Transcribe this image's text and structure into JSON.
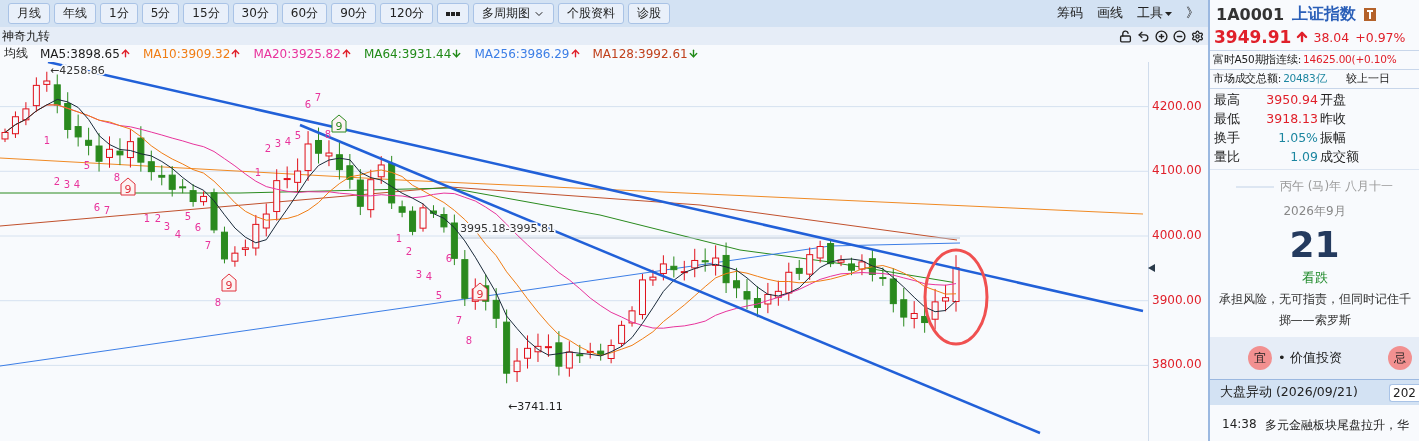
{
  "toolbar": {
    "periods": [
      {
        "kind": "text",
        "label": "月线"
      },
      {
        "kind": "text",
        "label": "年线"
      },
      {
        "kind": "text",
        "label": "1分"
      },
      {
        "kind": "text",
        "label": "5分"
      },
      {
        "kind": "text",
        "label": "15分"
      },
      {
        "kind": "text",
        "label": "30分"
      },
      {
        "kind": "text",
        "label": "60分"
      },
      {
        "kind": "text",
        "label": "90分"
      },
      {
        "kind": "text",
        "label": "120分"
      },
      {
        "kind": "more"
      },
      {
        "kind": "dropdown",
        "label": "多周期图"
      },
      {
        "kind": "text",
        "label": "个股资料"
      },
      {
        "kind": "text",
        "label": "诊股"
      }
    ],
    "links": [
      {
        "kind": "text",
        "label": "筹码"
      },
      {
        "kind": "text",
        "label": "画线"
      },
      {
        "kind": "dropdown",
        "label": "工具"
      },
      {
        "kind": "text",
        "label": "》"
      }
    ]
  },
  "indicator_bar": {
    "title": "神奇九转"
  },
  "legend": {
    "label": "均线",
    "items": [
      {
        "text": "MA5:3898.65",
        "color": "#1a1a1a",
        "rising": true
      },
      {
        "text": "MA10:3909.32",
        "color": "#f07d14",
        "rising": true
      },
      {
        "text": "MA20:3925.82",
        "color": "#e8339c",
        "rising": true
      },
      {
        "text": "MA64:3931.44",
        "color": "#218a18",
        "rising": false
      },
      {
        "text": "MA256:3986.29",
        "color": "#3c7ee6",
        "rising": true
      },
      {
        "text": "MA128:3992.61",
        "color": "#c0401c",
        "rising": false
      }
    ]
  },
  "chart": {
    "price_axis": [
      "4200.00",
      "4100.00",
      "4000.00",
      "3900.00",
      "3800.00"
    ],
    "annotations": [
      {
        "kind": "high",
        "text": "←4258.86"
      },
      {
        "kind": "range",
        "text": "3995.18-3995.81"
      },
      {
        "kind": "low",
        "text": "←3741.11"
      }
    ],
    "td_marks": [
      {
        "kind": "number",
        "text": "1"
      },
      {
        "kind": "number",
        "text": "2"
      },
      {
        "kind": "number",
        "text": "3"
      },
      {
        "kind": "number",
        "text": "4"
      },
      {
        "kind": "number",
        "text": "5"
      },
      {
        "kind": "number",
        "text": "6"
      },
      {
        "kind": "number",
        "text": "7"
      },
      {
        "kind": "number",
        "text": "8"
      },
      {
        "kind": "badge",
        "text": "9",
        "color": "#e0303c"
      },
      {
        "kind": "number",
        "text": "1"
      },
      {
        "kind": "number",
        "text": "2"
      },
      {
        "kind": "number",
        "text": "3"
      },
      {
        "kind": "number",
        "text": "4"
      },
      {
        "kind": "number",
        "text": "5"
      },
      {
        "kind": "number",
        "text": "6"
      },
      {
        "kind": "number",
        "text": "7"
      },
      {
        "kind": "number",
        "text": "8"
      },
      {
        "kind": "badge",
        "text": "9",
        "color": "#e0303c"
      },
      {
        "kind": "number",
        "text": "1"
      },
      {
        "kind": "number",
        "text": "2"
      },
      {
        "kind": "number",
        "text": "3"
      },
      {
        "kind": "number",
        "text": "4"
      },
      {
        "kind": "number",
        "text": "5"
      },
      {
        "kind": "number",
        "text": "6"
      },
      {
        "kind": "number",
        "text": "7"
      },
      {
        "kind": "number",
        "text": "8"
      },
      {
        "kind": "badge",
        "text": "9",
        "color": "#2a8a1e"
      },
      {
        "kind": "number",
        "text": "1"
      },
      {
        "kind": "number",
        "text": "2"
      },
      {
        "kind": "number",
        "text": "3"
      },
      {
        "kind": "number",
        "text": "4"
      },
      {
        "kind": "number",
        "text": "5"
      },
      {
        "kind": "number",
        "text": "6"
      },
      {
        "kind": "number",
        "text": "7"
      },
      {
        "kind": "number",
        "text": "8"
      },
      {
        "kind": "badge",
        "text": "9",
        "color": "#e0303c"
      }
    ]
  },
  "quote": {
    "code": "1A0001",
    "name": "上证指数",
    "price": "3949.91",
    "rising": true,
    "change": "38.04",
    "change_pct": "+0.97%",
    "a50_label": "富时A50期指连续:",
    "a50_value": "14625.00(+0.10%",
    "turnover_label": "市场成交总额:",
    "turnover_value": "20483亿",
    "compare_label": "较上一日",
    "stats": [
      {
        "label": "最高",
        "value": "3950.94",
        "color": "#e0202a",
        "label2": "开盘"
      },
      {
        "label": "最低",
        "value": "3918.13",
        "color": "#e0202a",
        "label2": "昨收"
      },
      {
        "label": "换手",
        "value": "1.05%",
        "color": "#1c86a0",
        "label2": "振幅"
      },
      {
        "label": "量比",
        "value": "1.09",
        "color": "#1c86a0",
        "label2": "成交额"
      }
    ]
  },
  "calendar": {
    "lunar": "丙午 (马)年 八月十一",
    "month": "2026年9月",
    "day": "21",
    "outlook": "看跌",
    "quote_lines": [
      "承担风险，无可指责，但同时记住千",
      "掷——索罗斯"
    ],
    "good": {
      "badge": "宜",
      "text": "• 价值投资"
    },
    "bad": {
      "badge": "忌"
    }
  },
  "news": {
    "title": "大盘异动 (2026/09/21)",
    "date_field": "202",
    "items": [
      {
        "time": "14:38",
        "text": "多元金融板块尾盘拉升，华"
      }
    ]
  }
}
